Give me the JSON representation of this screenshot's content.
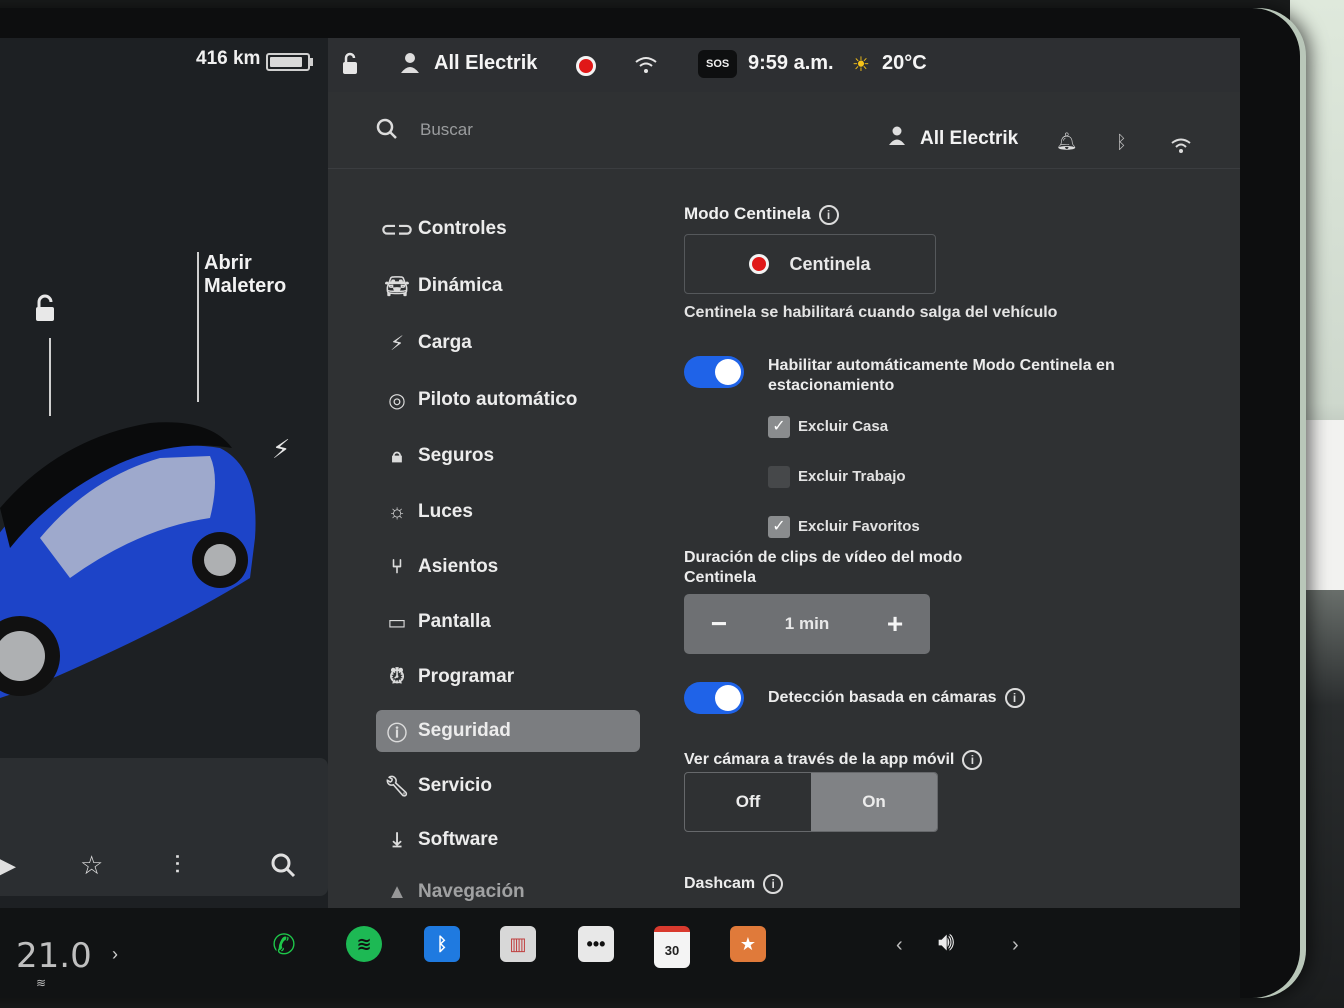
{
  "car": {
    "range": "416 km",
    "battery_level": 0.9,
    "trunk_label_1": "Abrir",
    "trunk_label_2": "Maletero"
  },
  "status_bar": {
    "profile": "All Electrik",
    "sos": "SOS",
    "time": "9:59 a.m.",
    "temperature": "20°C"
  },
  "search": {
    "placeholder": "Buscar",
    "profile": "All Electrik"
  },
  "nav": {
    "items": [
      {
        "label": "Controles"
      },
      {
        "label": "Dinámica"
      },
      {
        "label": "Carga"
      },
      {
        "label": "Piloto automático"
      },
      {
        "label": "Seguros"
      },
      {
        "label": "Luces"
      },
      {
        "label": "Asientos"
      },
      {
        "label": "Pantalla"
      },
      {
        "label": "Programar"
      },
      {
        "label": "Seguridad"
      },
      {
        "label": "Servicio"
      },
      {
        "label": "Software"
      },
      {
        "label": "Navegación"
      }
    ],
    "active": "Seguridad"
  },
  "sentry": {
    "title": "Modo Centinela",
    "button_label": "Centinela",
    "note": "Centinela se habilitará cuando salga del vehículo",
    "auto_enable_label": "Habilitar automáticamente Modo Centinela en estacionamiento",
    "auto_enable_on": true,
    "exclusions": [
      {
        "label": "Excluir Casa",
        "checked": true
      },
      {
        "label": "Excluir Trabajo",
        "checked": false
      },
      {
        "label": "Excluir Favoritos",
        "checked": true
      }
    ],
    "clip_duration_title": "Duración de clips de vídeo del modo Centinela",
    "clip_duration_value": "1 min",
    "camera_detection_label": "Detección basada en cámaras",
    "camera_detection_on": true,
    "mobile_view_title": "Ver cámara a través de la app móvil",
    "mobile_view_options": [
      "Off",
      "On"
    ],
    "mobile_view_selected": "On",
    "dashcam_title": "Dashcam"
  },
  "dock": {
    "cabin_temp": "21.0",
    "calendar_day": "30"
  },
  "colors": {
    "toggle_on": "#1f63e8",
    "record_red": "#e01818",
    "phone_green": "#1ec84a",
    "spotify_green": "#1db954",
    "bluetooth_blue": "#1f7ae0"
  }
}
